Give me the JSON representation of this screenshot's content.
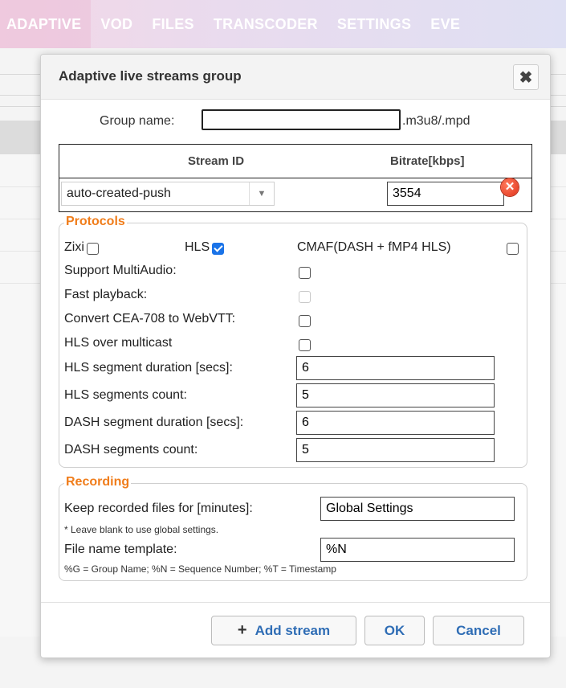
{
  "nav": {
    "items": [
      "ADAPTIVE",
      "VOD",
      "FILES",
      "TRANSCODER",
      "SETTINGS",
      "EVE"
    ]
  },
  "dialog": {
    "title": "Adaptive live streams group",
    "close_icon": "close-icon"
  },
  "group": {
    "label": "Group name:",
    "value": "",
    "suffix": ".m3u8/.mpd"
  },
  "streams": {
    "headers": {
      "stream_id": "Stream ID",
      "bitrate": "Bitrate[kbps]"
    },
    "rows": [
      {
        "stream_id": "auto-created-push",
        "bitrate": "3554"
      }
    ]
  },
  "protocols": {
    "legend": "Protocols",
    "zixi": {
      "label": "Zixi",
      "checked": false
    },
    "hls": {
      "label": "HLS",
      "checked": true
    },
    "cmaf": {
      "label": "CMAF(DASH + fMP4 HLS)",
      "checked": false
    },
    "support_multiaudio": {
      "label": "Support MultiAudio:",
      "checked": false
    },
    "fast_playback": {
      "label": "Fast playback:",
      "checked": false,
      "disabled": true
    },
    "convert_cea": {
      "label": "Convert CEA-708 to WebVTT:",
      "checked": false
    },
    "hls_multicast": {
      "label": "HLS over multicast",
      "checked": false
    },
    "hls_segment_duration": {
      "label": "HLS segment duration [secs]:",
      "value": "6"
    },
    "hls_segments_count": {
      "label": "HLS segments count:",
      "value": "5"
    },
    "dash_segment_duration": {
      "label": "DASH segment duration [secs]:",
      "value": "6"
    },
    "dash_segments_count": {
      "label": "DASH segments count:",
      "value": "5"
    }
  },
  "recording": {
    "legend": "Recording",
    "keep_label": "Keep recorded files for [minutes]:",
    "keep_value": "Global Settings",
    "keep_note": "* Leave blank to use global settings.",
    "template_label": "File name template:",
    "template_value": "%N",
    "template_note": "%G = Group Name; %N = Sequence Number; %T = Timestamp"
  },
  "buttons": {
    "add_stream": "Add stream",
    "ok": "OK",
    "cancel": "Cancel"
  },
  "colors": {
    "accent": "#2f6db5",
    "legend": "#f07d1b",
    "checkbox_checked": "#1a73e8",
    "remove": "#e0321a"
  }
}
